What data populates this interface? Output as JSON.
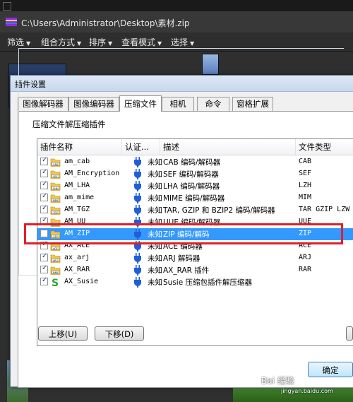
{
  "viewer": {
    "address": "C:\\Users\\Administrator\\Desktop\\素材.zip",
    "menu": [
      {
        "label": "筛选"
      },
      {
        "label": "组合方式"
      },
      {
        "label": "排序"
      },
      {
        "label": "查看模式"
      },
      {
        "label": "选择"
      }
    ]
  },
  "dialog": {
    "title": "插件设置",
    "tabs": [
      {
        "label": "图像解码器"
      },
      {
        "label": "图像编码器"
      },
      {
        "label": "压缩文件"
      },
      {
        "label": "相机"
      },
      {
        "label": "命令"
      },
      {
        "label": "窗格扩展"
      }
    ],
    "active_tab": "压缩文件",
    "group_label": "压缩文件解压缩插件",
    "columns": [
      "插件名称",
      "认证...",
      "描述",
      "文件类型"
    ],
    "rows": [
      {
        "checked": true,
        "icon": "cab-icon",
        "name": "am_cab",
        "cert": "未知",
        "desc": "CAB 编码/解码器",
        "type": "CAB"
      },
      {
        "checked": true,
        "icon": "sef-icon",
        "name": "AM_Encryption",
        "cert": "未知",
        "desc": "SEF 编码/解码器",
        "type": "SEF"
      },
      {
        "checked": true,
        "icon": "lha-icon",
        "name": "AM_LHA",
        "cert": "未知",
        "desc": "LHA 编码/解码器",
        "type": "LZH"
      },
      {
        "checked": true,
        "icon": "mim-icon",
        "name": "am_mime",
        "cert": "未知",
        "desc": "MIME 编码/解码器",
        "type": "MIM"
      },
      {
        "checked": true,
        "icon": "tgz-icon",
        "name": "AM_TGZ",
        "cert": "未知",
        "desc": "TAR, GZIP 和 BZIP2 编码/解码器",
        "type": "TAR GZIP LZW"
      },
      {
        "checked": true,
        "icon": "uue-icon",
        "name": "AM_UU",
        "cert": "未知",
        "desc": "UUE 编码/解码器",
        "type": "UUE"
      },
      {
        "checked": false,
        "icon": "zip-icon",
        "name": "AM_ZIP",
        "cert": "未知",
        "desc": "ZIP 编码/解码",
        "type": "ZIP",
        "selected": true
      },
      {
        "checked": true,
        "icon": "ace-icon",
        "name": "AX_ACE",
        "cert": "未知",
        "desc": "ACE 编码器",
        "type": "ACE"
      },
      {
        "checked": true,
        "icon": "arj-icon",
        "name": "ax_arj",
        "cert": "未知",
        "desc": "ARJ 解码器",
        "type": "ARJ"
      },
      {
        "checked": true,
        "icon": "rar-icon",
        "name": "AX_RAR",
        "cert": "未知",
        "desc": "AX_RAR 插件",
        "type": "RAR"
      },
      {
        "checked": true,
        "icon": "susie-icon",
        "name": "AX_Susie",
        "cert": "未知",
        "desc": "Susie 压缩包插件解压缩器",
        "type": ""
      }
    ],
    "buttons": {
      "move_up": "上移(U)",
      "move_down": "下移(D)",
      "ok": "确定"
    }
  },
  "watermark": {
    "text": "Bai 经验",
    "sub": "jingyan.baidu.com"
  },
  "colors": {
    "selection": "#3399ff",
    "highlight_box": "#e0202a",
    "plug_icon": "#1f5fd6"
  }
}
